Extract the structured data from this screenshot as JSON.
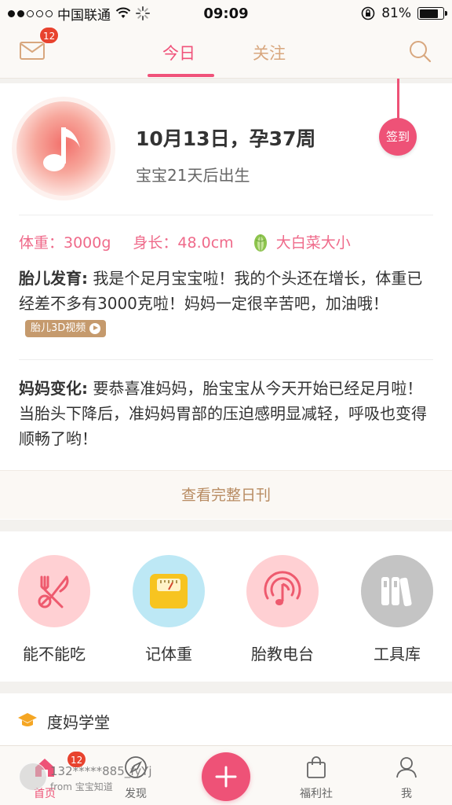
{
  "status_bar": {
    "carrier": "中国联通",
    "time": "09:09",
    "battery_percent": "81%",
    "battery_level": 0.81
  },
  "top_nav": {
    "message_badge": "12",
    "tabs": [
      {
        "label": "今日",
        "active": true
      },
      {
        "label": "关注",
        "active": false
      }
    ]
  },
  "daily": {
    "checkin_label": "签到",
    "date_title": "10月13日，孕37周",
    "birth_countdown": "宝宝21天后出生",
    "weight": "体重：3000g",
    "length": "身长：48.0cm",
    "size_compare": "大白菜大小",
    "fetal_label": "胎儿发育:",
    "fetal_text": "我是个足月宝宝啦！我的个头还在增长，体重已经差不多有3000克啦！妈妈一定很辛苦吧，加油哦！",
    "video_label": "胎儿3D视频",
    "mom_label": "妈妈变化:",
    "mom_text": "要恭喜准妈妈，胎宝宝从今天开始已经足月啦！当胎头下降后，准妈妈胃部的压迫感明显减轻，呼吸也变得顺畅了哟！",
    "full_report": "查看完整日刊"
  },
  "tools": [
    {
      "label": "能不能吃",
      "icon": "food-check-icon",
      "color": "#ffd0d3"
    },
    {
      "label": "记体重",
      "icon": "scale-icon",
      "color": "#bde8f5"
    },
    {
      "label": "胎教电台",
      "icon": "music-radio-icon",
      "color": "#ffd0d3"
    },
    {
      "label": "工具库",
      "icon": "library-icon",
      "color": "#c4c4c4"
    }
  ],
  "school": {
    "title": "度妈学堂"
  },
  "tab_bar": {
    "home": "首页",
    "home_badge": "12",
    "discover": "发现",
    "welfare": "福利社",
    "me": "我"
  },
  "watermark": {
    "user": "132*****885_fyYj",
    "from": "from 宝宝知道"
  },
  "colors": {
    "accent": "#ee5277",
    "gold": "#b88b62",
    "badge": "#e8432e"
  }
}
